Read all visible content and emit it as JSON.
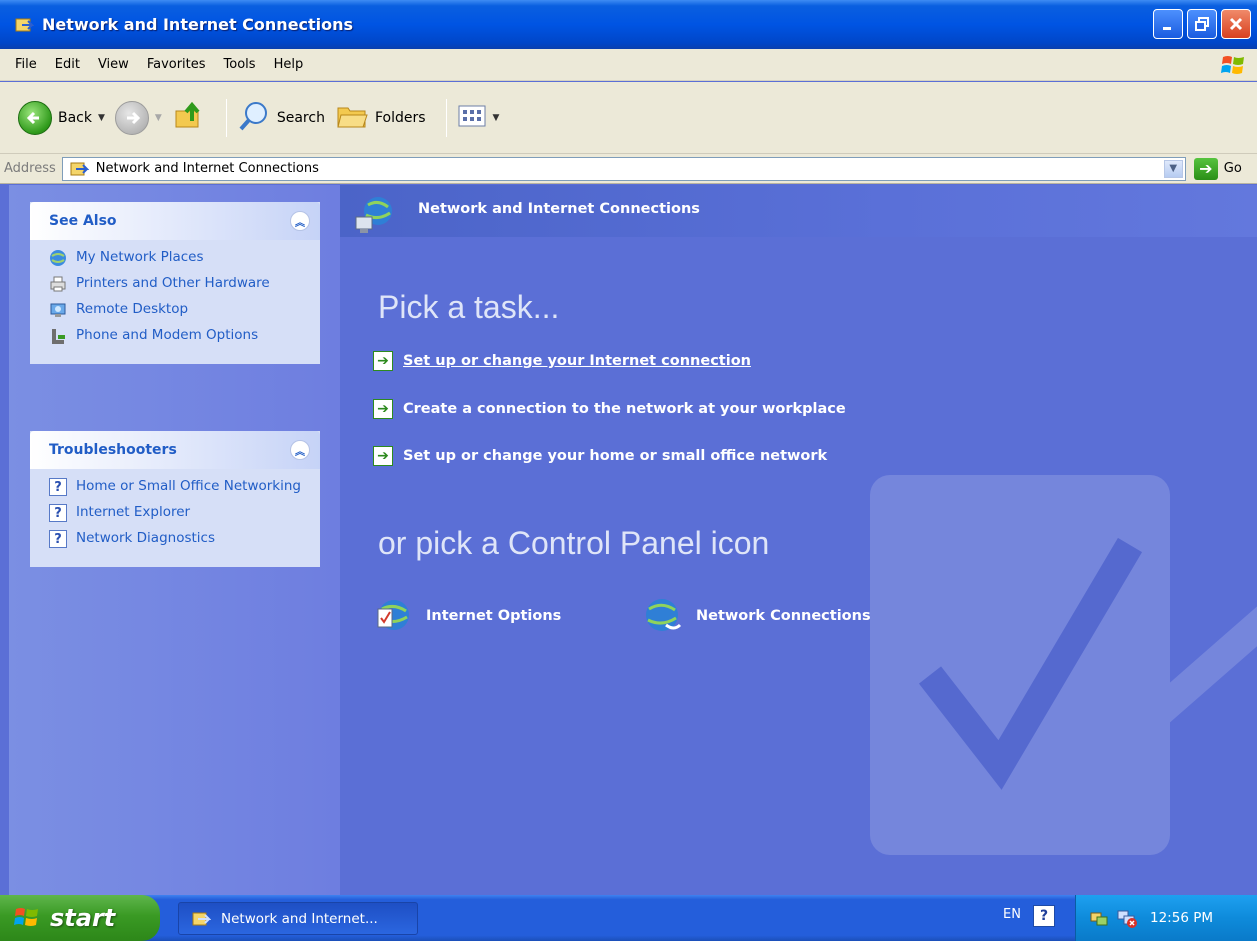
{
  "window": {
    "title": "Network and Internet Connections"
  },
  "menu": [
    "File",
    "Edit",
    "View",
    "Favorites",
    "Tools",
    "Help"
  ],
  "toolbar": {
    "back": "Back",
    "search": "Search",
    "folders": "Folders"
  },
  "address": {
    "label": "Address",
    "value": "Network and Internet Connections",
    "go": "Go"
  },
  "see_also": {
    "title": "See Also",
    "items": [
      {
        "label": "My Network Places",
        "icon": "network-places-icon"
      },
      {
        "label": "Printers and Other Hardware",
        "icon": "printer-icon"
      },
      {
        "label": "Remote Desktop",
        "icon": "remote-desktop-icon"
      },
      {
        "label": "Phone and Modem Options",
        "icon": "phone-icon"
      }
    ]
  },
  "troubleshooters": {
    "title": "Troubleshooters",
    "items": [
      {
        "label": "Home or Small Office Networking"
      },
      {
        "label": "Internet Explorer"
      },
      {
        "label": "Network Diagnostics"
      }
    ]
  },
  "main": {
    "title": "Network and Internet Connections",
    "pick_task": "Pick a task...",
    "tasks": [
      "Set up or change your Internet connection",
      "Create a connection to the network at your workplace",
      "Set up or change your home or small office network"
    ],
    "or_pick": "or pick a Control Panel icon",
    "icons": [
      {
        "label": "Internet Options"
      },
      {
        "label": "Network Connections"
      }
    ]
  },
  "taskbar": {
    "start": "start",
    "task_button": "Network and Internet...",
    "language": "EN",
    "clock": "12:56 PM"
  },
  "colors": {
    "titlebar": "#0054e3",
    "main_background": "#5b6fd6",
    "link": "#215dc6",
    "start_green": "#3a9a24"
  }
}
